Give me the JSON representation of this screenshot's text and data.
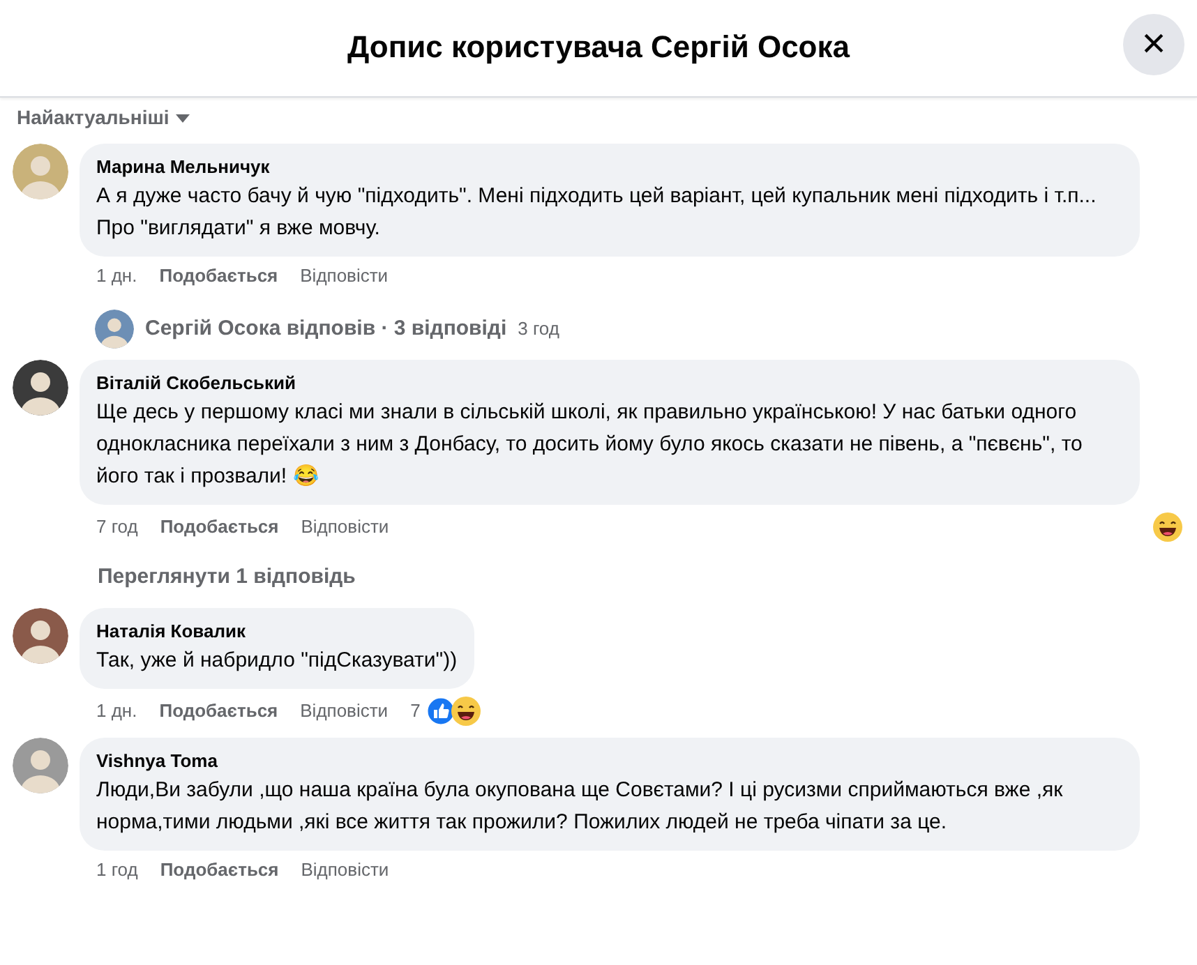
{
  "dialog": {
    "title": "Допис користувача Сергій Осока",
    "close": "×"
  },
  "sort_label": "Найактуальніші",
  "items": [
    {
      "kind": "comment",
      "author": "Марина Мельничук",
      "text": "А я дуже часто бачу й чую \"підходить\". Мені підходить цей варіант, цей купальник мені підходить і т.п... Про \"виглядати\" я вже мовчу.",
      "time": "1 дн.",
      "like": "Подобається",
      "reply": "Відповісти"
    },
    {
      "kind": "replies_summary",
      "text": "Сергій Осока відповів · 3 відповіді",
      "time": "3 год"
    },
    {
      "kind": "comment",
      "author": "Віталій Скобельський",
      "text": "Ще десь у першому класі ми знали в сільській школі, як правильно українською! У нас батьки одного однокласника переїхали з ним з Донбасу, то досить йому було якось сказати не півень, а \"пєвєнь\", то його так і прозвали! 😂",
      "time": "7 год",
      "like": "Подобається",
      "reply": "Відповісти",
      "reactions": [
        {
          "kind": "haha"
        }
      ]
    },
    {
      "kind": "view_replies",
      "text": "Переглянути 1 відповідь"
    },
    {
      "kind": "comment",
      "author": "Наталія Ковалик",
      "text": "Так, уже й набридло \"підСказувати\"))",
      "time": "1 дн.",
      "like": "Подобається",
      "reply": "Відповісти",
      "reaction_count": "7",
      "reactions": [
        {
          "kind": "like"
        },
        {
          "kind": "haha"
        }
      ]
    },
    {
      "kind": "comment",
      "author": "Vishnya Toma",
      "text": "Люди,Ви забули ,що наша країна була окупована ще Совєтами? І ці русизми сприймаються вже ,як норма,тими людьми ,які все життя так прожили? Пожилих людей не треба чіпати за це.",
      "time": "1 год",
      "like": "Подобається",
      "reply": "Відповісти"
    }
  ]
}
